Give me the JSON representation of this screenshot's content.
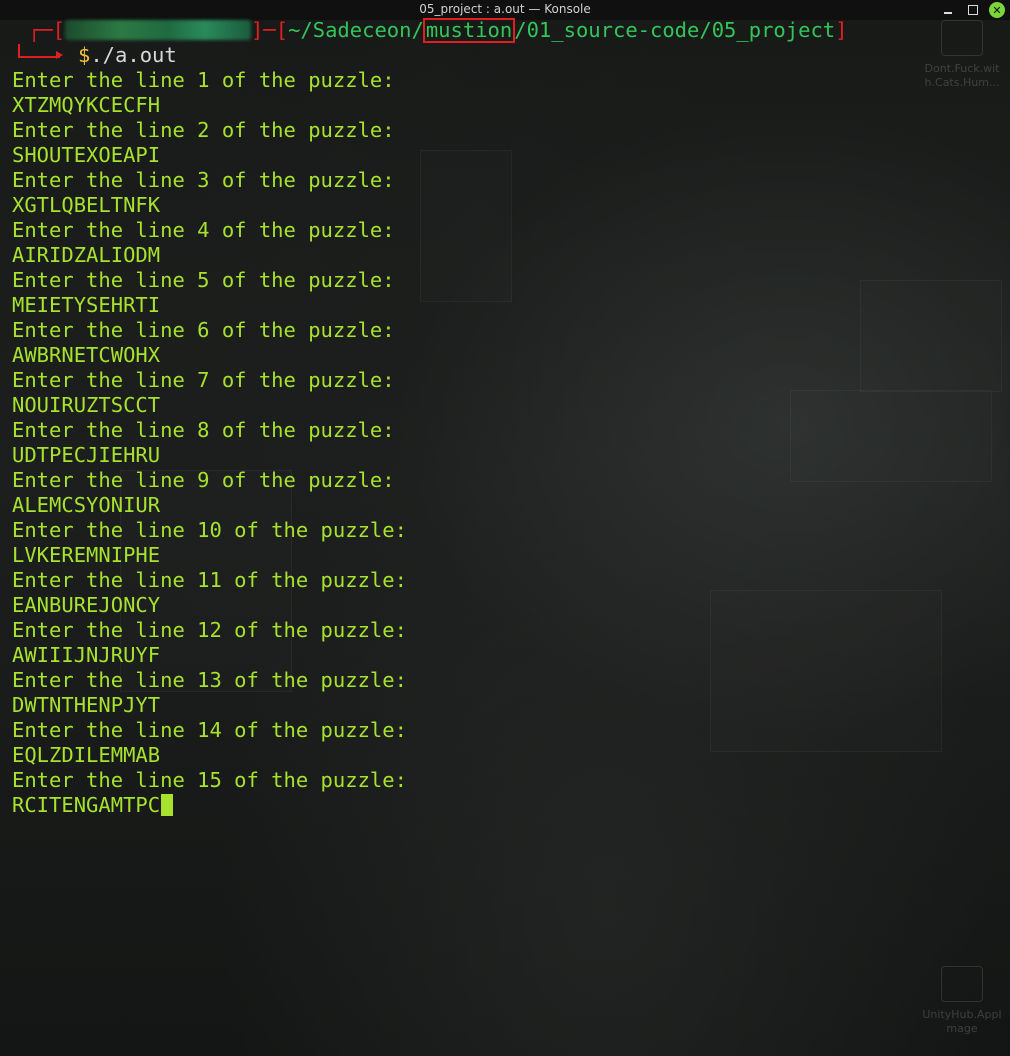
{
  "window": {
    "title": "05_project : a.out — Konsole"
  },
  "prompt": {
    "open_bracket": "┌─[",
    "close_sep": "]─[",
    "path_prefix": "~/Sadeceon/",
    "path_highlight": "mustion",
    "path_suffix": "/01_source-code/05_project",
    "close_bracket": "]",
    "dollar": "$",
    "command": "./a.out"
  },
  "output_lines": [
    "Enter the line 1 of the puzzle:",
    "XTZMQYKCECFH",
    "Enter the line 2 of the puzzle:",
    "SHOUTEXOEAPI",
    "Enter the line 3 of the puzzle:",
    "XGTLQBELTNFK",
    "Enter the line 4 of the puzzle:",
    "AIRIDZALIODM",
    "Enter the line 5 of the puzzle:",
    "MEIETYSEHRTI",
    "Enter the line 6 of the puzzle:",
    "AWBRNETCWOHX",
    "Enter the line 7 of the puzzle:",
    "NOUIRUZTSCCT",
    "Enter the line 8 of the puzzle:",
    "UDTPECJIEHRU",
    "Enter the line 9 of the puzzle:",
    "ALEMCSYONIUR",
    "Enter the line 10 of the puzzle:",
    "LVKEREMNIPHE",
    "Enter the line 11 of the puzzle:",
    "EANBUREJONCY",
    "Enter the line 12 of the puzzle:",
    "AWIIIJNJRUYF",
    "Enter the line 13 of the puzzle:",
    "DWTNTHENPJYT",
    "Enter the line 14 of the puzzle:",
    "EQLZDILEMMAB",
    "Enter the line 15 of the puzzle:"
  ],
  "current_input": "RCITENGAMTPC",
  "desktop_icons": [
    {
      "label_line1": "Dont.Fuck.wit",
      "label_line2": "h.Cats.Hum..."
    },
    {
      "label_line1": "UnityHub.AppI",
      "label_line2": "mage"
    }
  ],
  "colors": {
    "output_green": "#a6e22e",
    "prompt_red": "#e02020",
    "path_green": "#33c55a",
    "dollar_yellow": "#f0c040",
    "close_button": "#7cd63a"
  }
}
